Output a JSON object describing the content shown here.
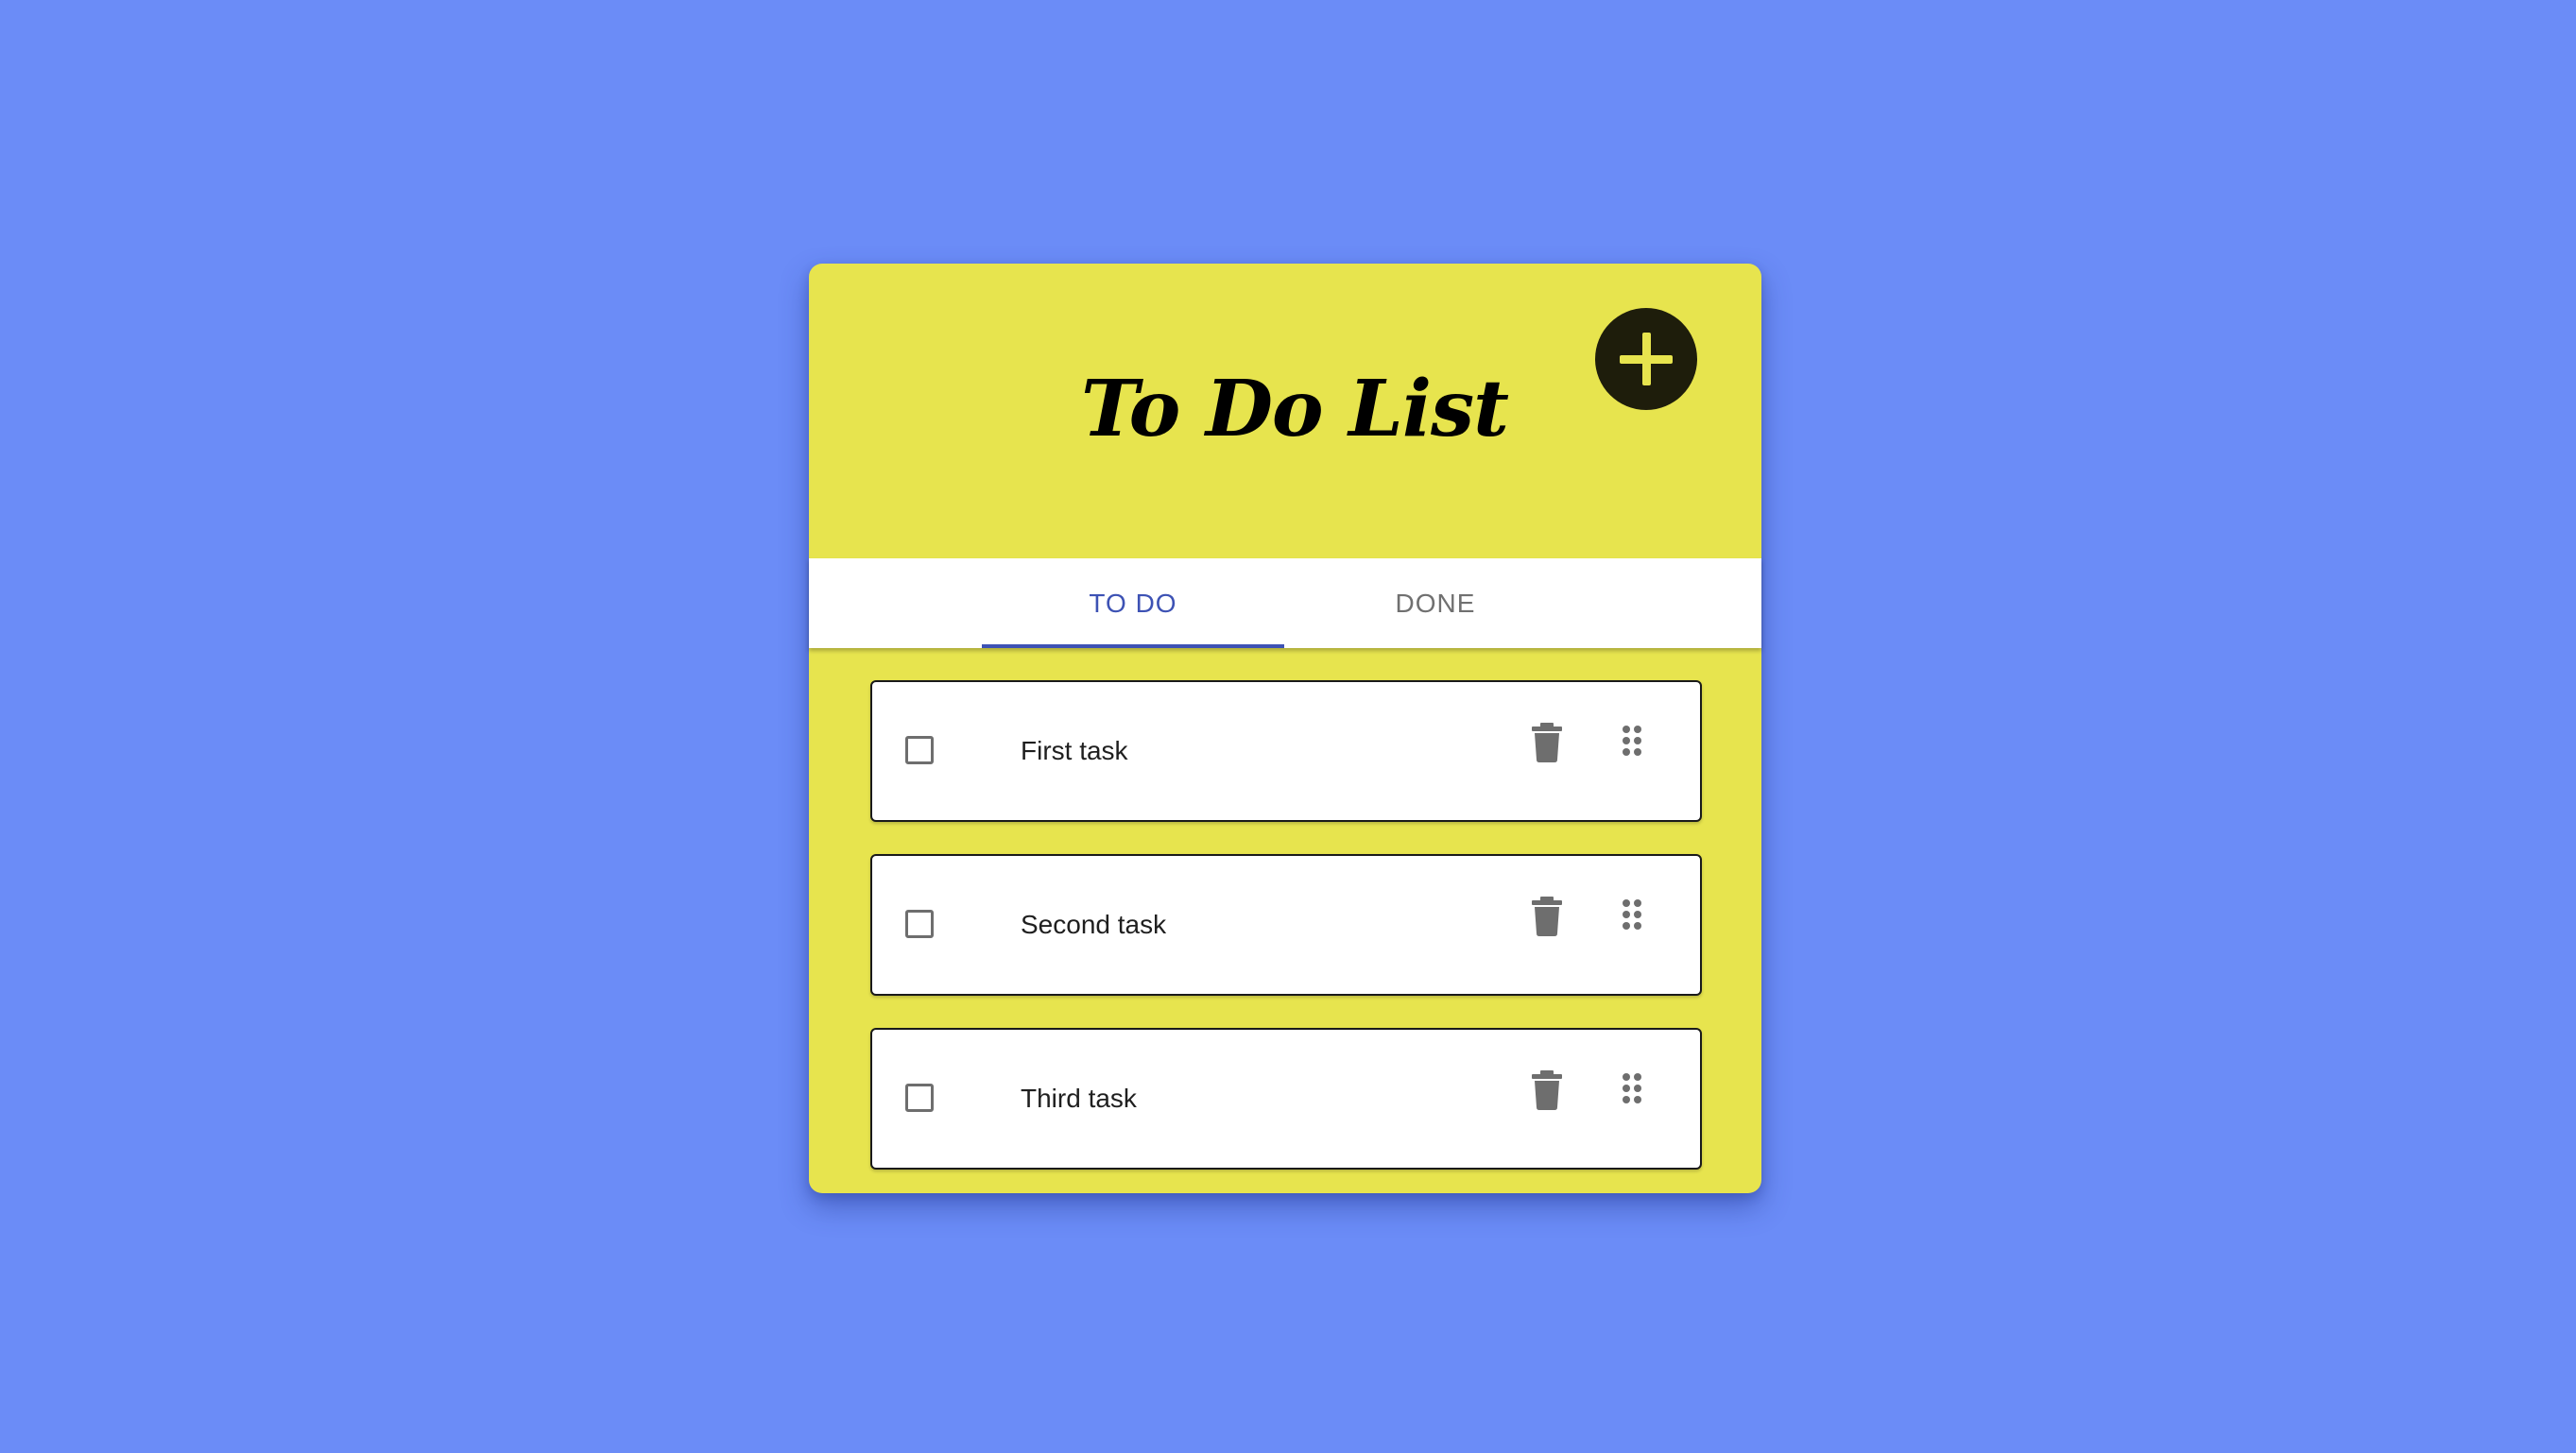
{
  "app": {
    "title": "To Do List",
    "add_button_icon": "plus-icon"
  },
  "colors": {
    "background": "#6b8cf7",
    "card": "#e7e44e",
    "accent": "#3d52b4",
    "add_button": "#1e1d0b"
  },
  "tabs": [
    {
      "label": "TO DO",
      "active": true
    },
    {
      "label": "DONE",
      "active": false
    }
  ],
  "tasks": [
    {
      "label": "First task",
      "checked": false
    },
    {
      "label": "Second task",
      "checked": false
    },
    {
      "label": "Third task",
      "checked": false
    }
  ],
  "icons": {
    "delete": "trash-icon",
    "drag": "drag-handle-icon",
    "checkbox": "checkbox-unchecked-icon"
  }
}
